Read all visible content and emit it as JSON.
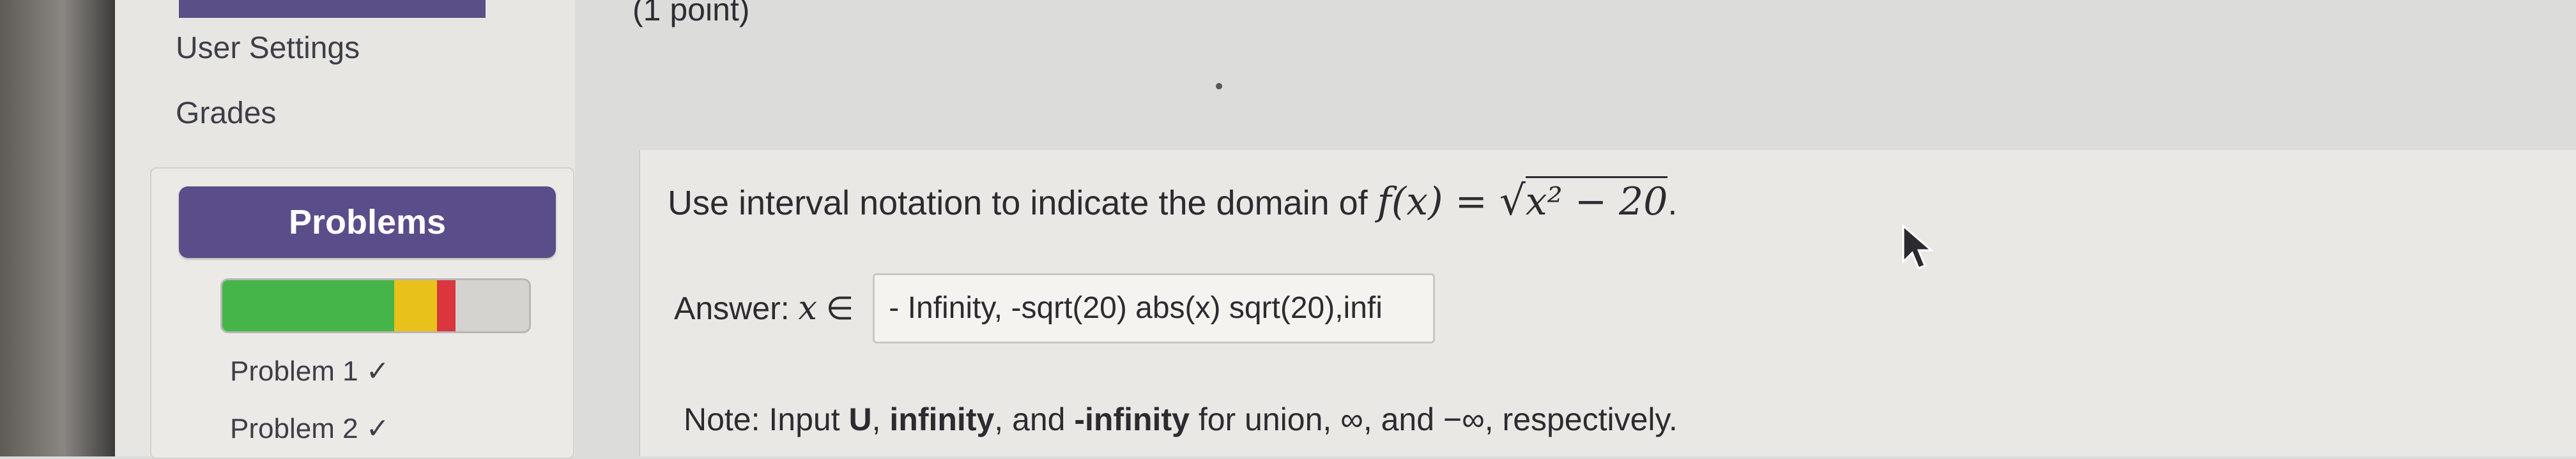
{
  "header": {
    "point_label": "(1 point)"
  },
  "sidebar": {
    "links": [
      {
        "label": "User Settings"
      },
      {
        "label": "Grades"
      }
    ],
    "problems_button": "Problems",
    "progress": {
      "correct": 0.56,
      "partial": 0.14,
      "incorrect": 0.06
    },
    "progress_colors": {
      "correct": "#45b549",
      "partial": "#e8c21b",
      "incorrect": "#d9363e"
    },
    "problems": [
      {
        "label": "Problem 1 ✓"
      },
      {
        "label": "Problem 2 ✓"
      }
    ]
  },
  "question": {
    "prefix": "Use interval notation to indicate the domain of ",
    "func_lhs": "f(x)",
    "equals": " = ",
    "sqrt_symbol": "√",
    "radicand": "x² − 20",
    "suffix": "."
  },
  "answer": {
    "label": "Answer: ",
    "variable": "x",
    "element_of": " ∈",
    "value": "- Infinity, -sqrt(20) abs(x) sqrt(20),infi"
  },
  "note": {
    "prefix": "Note: Input ",
    "union_kw": "U",
    "sep1": ", ",
    "infinity_kw": "infinity",
    "sep2": ", and ",
    "neg_infinity_kw": "-infinity",
    "suffix": " for union, ∞, and −∞, respectively."
  }
}
